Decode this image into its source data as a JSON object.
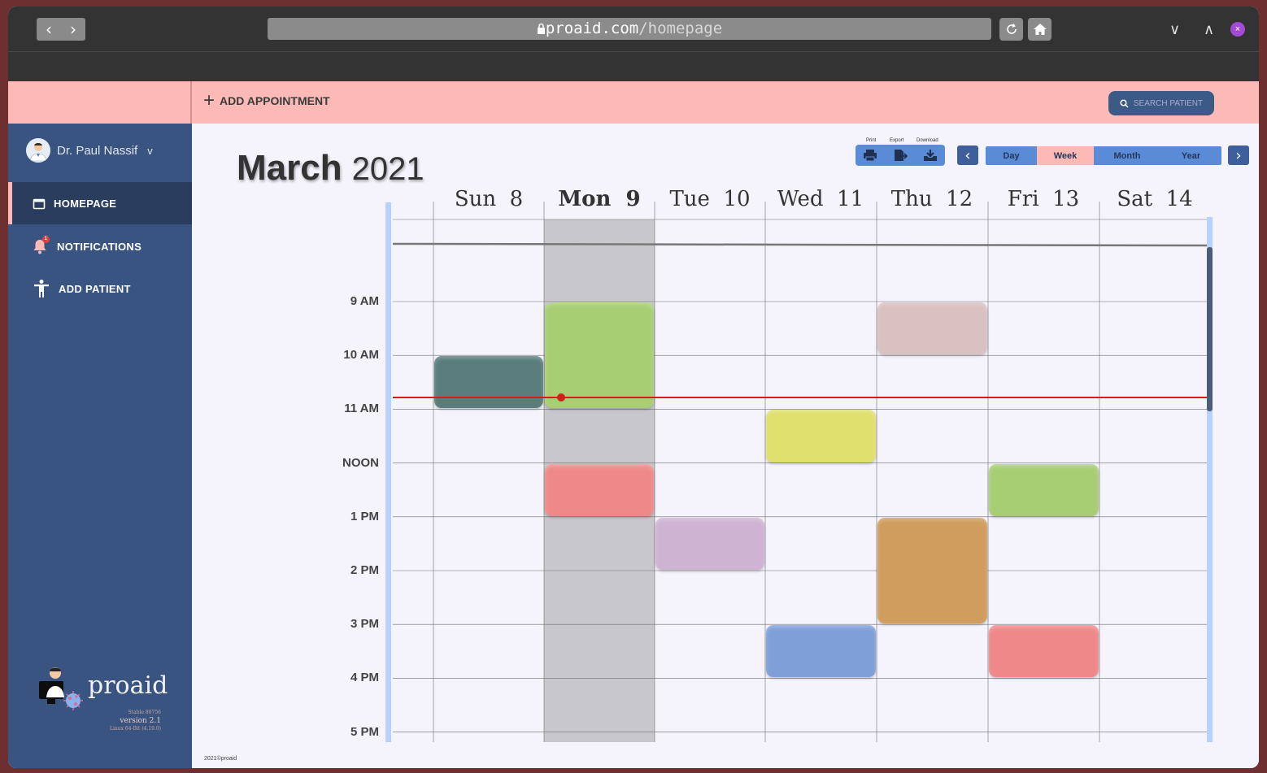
{
  "browser": {
    "url_host": "proaid.com",
    "url_path": "/homepage",
    "back_glyph": "‹",
    "forward_glyph": "›",
    "minimize_glyph": "∨",
    "maximize_glyph": "∧",
    "close_glyph": "×"
  },
  "topbar": {
    "add_appointment": "ADD APPOINTMENT",
    "add_icon_glyph": "+",
    "search_label": "SEARCH PATIENT"
  },
  "sidebar": {
    "user_name": "Dr. Paul Nassif",
    "user_menu_glyph": "v",
    "items": [
      {
        "label": "HOMEPAGE",
        "icon": "calendar-icon",
        "active": true
      },
      {
        "label": "NOTIFICATIONS",
        "icon": "bell-icon",
        "active": false,
        "badge": "1"
      },
      {
        "label": "ADD PATIENT",
        "icon": "person-icon",
        "active": false
      }
    ],
    "brand": {
      "name": "proaid",
      "build": "Stable 80756",
      "version": "version 2.1",
      "platform": "Linux 64-Bit (4.19.0)"
    }
  },
  "calendar": {
    "month": "March",
    "year": "2021",
    "tools": {
      "print": "Print",
      "export": "Export",
      "download": "Download"
    },
    "views": [
      "Day",
      "Week",
      "Month",
      "Year"
    ],
    "selected_view": "Week",
    "prev_glyph": "‹",
    "next_glyph": "›",
    "days": [
      {
        "name": "Sun",
        "num": "8"
      },
      {
        "name": "Mon",
        "num": "9",
        "today": true
      },
      {
        "name": "Tue",
        "num": "10"
      },
      {
        "name": "Wed",
        "num": "11"
      },
      {
        "name": "Thu",
        "num": "12"
      },
      {
        "name": "Fri",
        "num": "13"
      },
      {
        "name": "Sat",
        "num": "14"
      }
    ],
    "hours": [
      "9 AM",
      "10 AM",
      "11 AM",
      "NOON",
      "1 PM",
      "2 PM",
      "3 PM",
      "4 PM",
      "5 PM"
    ],
    "colors": {
      "today_column": "#c8c8cc",
      "now_line": "#d81c1c",
      "grid": "#6e6e6e",
      "side_bar": "#b7d3fb"
    },
    "appointments": [
      {
        "day": 0,
        "start": 10.0,
        "end": 11.0,
        "color": "#597d7c"
      },
      {
        "day": 1,
        "start": 9.0,
        "end": 11.0,
        "color": "#a8ce74"
      },
      {
        "day": 1,
        "start": 12.0,
        "end": 13.0,
        "color": "#ef8989"
      },
      {
        "day": 2,
        "start": 13.0,
        "end": 14.0,
        "color": "#ceb4d2"
      },
      {
        "day": 3,
        "start": 11.0,
        "end": 12.0,
        "color": "#dfe06e"
      },
      {
        "day": 3,
        "start": 15.0,
        "end": 16.0,
        "color": "#7f9fd8"
      },
      {
        "day": 4,
        "start": 9.0,
        "end": 10.0,
        "color": "#d8c1c0"
      },
      {
        "day": 4,
        "start": 13.0,
        "end": 15.0,
        "color": "#d09d5e"
      },
      {
        "day": 5,
        "start": 12.0,
        "end": 13.0,
        "color": "#a8ce74"
      },
      {
        "day": 5,
        "start": 15.0,
        "end": 16.0,
        "color": "#ef8989"
      }
    ],
    "now_hour": 10.78
  },
  "footer": {
    "copyright": "2021©proaid"
  }
}
